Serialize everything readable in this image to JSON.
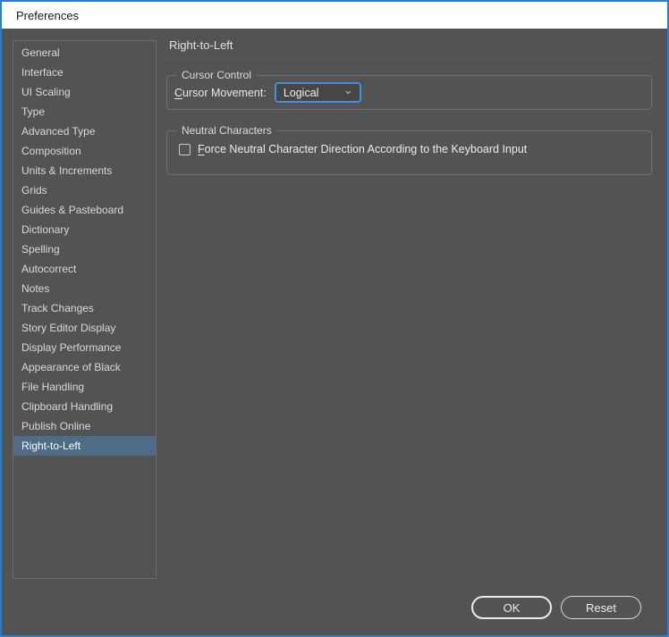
{
  "window": {
    "title": "Preferences"
  },
  "sidebar": {
    "items": [
      {
        "label": "General"
      },
      {
        "label": "Interface"
      },
      {
        "label": "UI Scaling"
      },
      {
        "label": "Type"
      },
      {
        "label": "Advanced Type"
      },
      {
        "label": "Composition"
      },
      {
        "label": "Units & Increments"
      },
      {
        "label": "Grids"
      },
      {
        "label": "Guides & Pasteboard"
      },
      {
        "label": "Dictionary"
      },
      {
        "label": "Spelling"
      },
      {
        "label": "Autocorrect"
      },
      {
        "label": "Notes"
      },
      {
        "label": "Track Changes"
      },
      {
        "label": "Story Editor Display"
      },
      {
        "label": "Display Performance"
      },
      {
        "label": "Appearance of Black"
      },
      {
        "label": "File Handling"
      },
      {
        "label": "Clipboard Handling"
      },
      {
        "label": "Publish Online"
      },
      {
        "label": "Right-to-Left",
        "selected": true
      }
    ]
  },
  "main": {
    "heading": "Right-to-Left",
    "cursor_control": {
      "legend": "Cursor Control",
      "label_mnemonic": "C",
      "label_rest": "ursor Movement:",
      "dropdown_value": "Logical"
    },
    "neutral_characters": {
      "legend": "Neutral Characters",
      "checkbox_checked": false,
      "label_mnemonic": "F",
      "label_rest": "orce Neutral Character Direction According to the Keyboard Input"
    }
  },
  "footer": {
    "ok_label": "OK",
    "reset_label": "Reset"
  },
  "icons": {
    "chevron_down": "⌄"
  },
  "colors": {
    "window_border": "#1e82d8",
    "titlebar_bg": "#ffffff",
    "dialog_bg": "#535353",
    "selection": "#4f6b85",
    "dropdown_focus_border": "#3f8fe0"
  }
}
